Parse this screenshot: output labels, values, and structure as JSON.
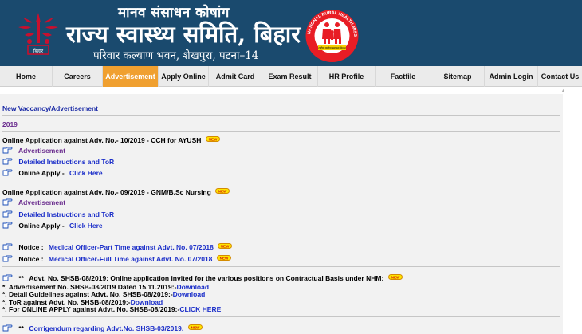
{
  "header": {
    "title_small": "मानव संसाधन कोषांग",
    "title_big": "राज्य स्वास्थ्य समिति, बिहार",
    "title_sub": "परिवार कल्याण भवन, शेखपुरा, पटना–14",
    "logo_left_text": "बिहार",
    "logo_right_ring_text": "NATIONAL RURAL HEALTH MISSION",
    "logo_right_bottom_text": "राष्ट्रीय ग्रामीण स्वास्थ्य मिशन",
    "colors": {
      "header_bg": "#1a4a6e",
      "nav_active": "#f0a030",
      "link_blue": "#1c2fc9"
    }
  },
  "nav": {
    "items": [
      {
        "label": "Home"
      },
      {
        "label": "Careers"
      },
      {
        "label": "Advertisement",
        "active": true
      },
      {
        "label": "Apply Online"
      },
      {
        "label": "Admit Card"
      },
      {
        "label": "Exam Result"
      },
      {
        "label": "HR Profile"
      },
      {
        "label": "Factfile"
      },
      {
        "label": "Sitemap"
      },
      {
        "label": "Admin Login"
      },
      {
        "label": "Contact Us"
      }
    ]
  },
  "content": {
    "section_title": "New Vaccancy/Advertisement",
    "year": "2019",
    "badge": "NEW",
    "block1": {
      "title": "Online Application against Adv. No.- 10/2019 - CCH for AYUSH",
      "advertisement": "Advertisement",
      "instructions": "Detailed Instructions and ToR",
      "apply_label": "Online Apply -",
      "apply_link": "Click Here"
    },
    "block2": {
      "title": "Online Application against Adv. No.- 09/2019 - GNM/B.Sc Nursing",
      "advertisement": "Advertisement",
      "instructions": "Detailed Instructions and ToR",
      "apply_label": "Online Apply -",
      "apply_link": "Click Here"
    },
    "notices": [
      {
        "label": "Notice :",
        "link": "Medical Officer-Part Time against Advt. No. 07/2018"
      },
      {
        "label": "Notice :",
        "link": "Medical Officer-Full Time against Advt. No. 07/2018"
      }
    ],
    "block3": {
      "stars": "**",
      "title": "Advt. No. SHSB-08/2019: Online application invited for the various positions on Contractual Basis under NHM:",
      "lines": [
        {
          "text": "*. Advertisement No. SHSB-08/2019 Dated 15.11.2019:-",
          "link": "Download"
        },
        {
          "text": "*. Detail Guidelines against Advt. No. SHSB-08/2019:-",
          "link": "Download"
        },
        {
          "text": "*. ToR against Advt. No. SHSB-08/2019:-",
          "link": "Download"
        },
        {
          "text": "*. For ONLINE APPLY against Advt. No. SHSB-08/2019:-",
          "link": "CLICK HERE"
        }
      ]
    },
    "block4": {
      "stars": "**",
      "link": "Corrigendum regarding Advt.No. SHSB-03/2019."
    }
  }
}
